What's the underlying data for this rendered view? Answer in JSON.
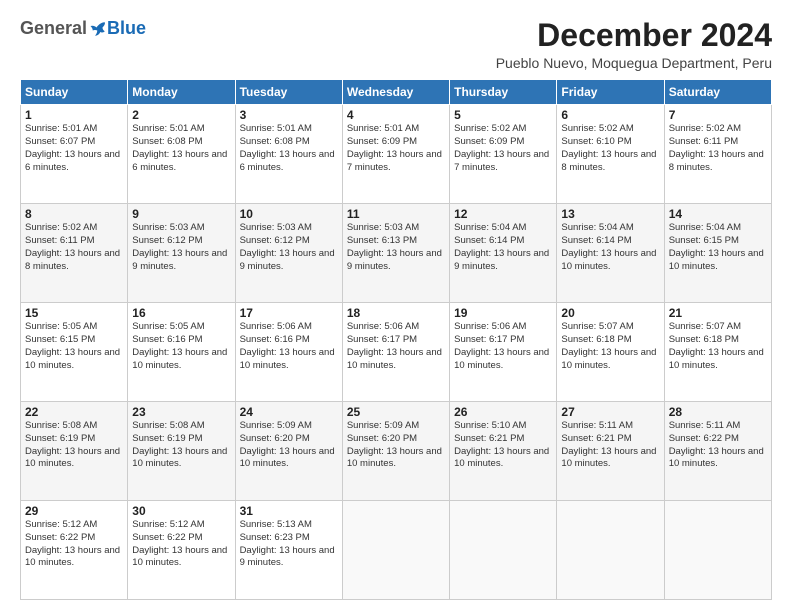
{
  "header": {
    "logo_general": "General",
    "logo_blue": "Blue",
    "month_title": "December 2024",
    "location": "Pueblo Nuevo, Moquegua Department, Peru"
  },
  "weekdays": [
    "Sunday",
    "Monday",
    "Tuesday",
    "Wednesday",
    "Thursday",
    "Friday",
    "Saturday"
  ],
  "weeks": [
    [
      {
        "day": "1",
        "sunrise": "5:01 AM",
        "sunset": "6:07 PM",
        "daylight": "13 hours and 6 minutes."
      },
      {
        "day": "2",
        "sunrise": "5:01 AM",
        "sunset": "6:08 PM",
        "daylight": "13 hours and 6 minutes."
      },
      {
        "day": "3",
        "sunrise": "5:01 AM",
        "sunset": "6:08 PM",
        "daylight": "13 hours and 6 minutes."
      },
      {
        "day": "4",
        "sunrise": "5:01 AM",
        "sunset": "6:09 PM",
        "daylight": "13 hours and 7 minutes."
      },
      {
        "day": "5",
        "sunrise": "5:02 AM",
        "sunset": "6:09 PM",
        "daylight": "13 hours and 7 minutes."
      },
      {
        "day": "6",
        "sunrise": "5:02 AM",
        "sunset": "6:10 PM",
        "daylight": "13 hours and 8 minutes."
      },
      {
        "day": "7",
        "sunrise": "5:02 AM",
        "sunset": "6:11 PM",
        "daylight": "13 hours and 8 minutes."
      }
    ],
    [
      {
        "day": "8",
        "sunrise": "5:02 AM",
        "sunset": "6:11 PM",
        "daylight": "13 hours and 8 minutes."
      },
      {
        "day": "9",
        "sunrise": "5:03 AM",
        "sunset": "6:12 PM",
        "daylight": "13 hours and 9 minutes."
      },
      {
        "day": "10",
        "sunrise": "5:03 AM",
        "sunset": "6:12 PM",
        "daylight": "13 hours and 9 minutes."
      },
      {
        "day": "11",
        "sunrise": "5:03 AM",
        "sunset": "6:13 PM",
        "daylight": "13 hours and 9 minutes."
      },
      {
        "day": "12",
        "sunrise": "5:04 AM",
        "sunset": "6:14 PM",
        "daylight": "13 hours and 9 minutes."
      },
      {
        "day": "13",
        "sunrise": "5:04 AM",
        "sunset": "6:14 PM",
        "daylight": "13 hours and 10 minutes."
      },
      {
        "day": "14",
        "sunrise": "5:04 AM",
        "sunset": "6:15 PM",
        "daylight": "13 hours and 10 minutes."
      }
    ],
    [
      {
        "day": "15",
        "sunrise": "5:05 AM",
        "sunset": "6:15 PM",
        "daylight": "13 hours and 10 minutes."
      },
      {
        "day": "16",
        "sunrise": "5:05 AM",
        "sunset": "6:16 PM",
        "daylight": "13 hours and 10 minutes."
      },
      {
        "day": "17",
        "sunrise": "5:06 AM",
        "sunset": "6:16 PM",
        "daylight": "13 hours and 10 minutes."
      },
      {
        "day": "18",
        "sunrise": "5:06 AM",
        "sunset": "6:17 PM",
        "daylight": "13 hours and 10 minutes."
      },
      {
        "day": "19",
        "sunrise": "5:06 AM",
        "sunset": "6:17 PM",
        "daylight": "13 hours and 10 minutes."
      },
      {
        "day": "20",
        "sunrise": "5:07 AM",
        "sunset": "6:18 PM",
        "daylight": "13 hours and 10 minutes."
      },
      {
        "day": "21",
        "sunrise": "5:07 AM",
        "sunset": "6:18 PM",
        "daylight": "13 hours and 10 minutes."
      }
    ],
    [
      {
        "day": "22",
        "sunrise": "5:08 AM",
        "sunset": "6:19 PM",
        "daylight": "13 hours and 10 minutes."
      },
      {
        "day": "23",
        "sunrise": "5:08 AM",
        "sunset": "6:19 PM",
        "daylight": "13 hours and 10 minutes."
      },
      {
        "day": "24",
        "sunrise": "5:09 AM",
        "sunset": "6:20 PM",
        "daylight": "13 hours and 10 minutes."
      },
      {
        "day": "25",
        "sunrise": "5:09 AM",
        "sunset": "6:20 PM",
        "daylight": "13 hours and 10 minutes."
      },
      {
        "day": "26",
        "sunrise": "5:10 AM",
        "sunset": "6:21 PM",
        "daylight": "13 hours and 10 minutes."
      },
      {
        "day": "27",
        "sunrise": "5:11 AM",
        "sunset": "6:21 PM",
        "daylight": "13 hours and 10 minutes."
      },
      {
        "day": "28",
        "sunrise": "5:11 AM",
        "sunset": "6:22 PM",
        "daylight": "13 hours and 10 minutes."
      }
    ],
    [
      {
        "day": "29",
        "sunrise": "5:12 AM",
        "sunset": "6:22 PM",
        "daylight": "13 hours and 10 minutes."
      },
      {
        "day": "30",
        "sunrise": "5:12 AM",
        "sunset": "6:22 PM",
        "daylight": "13 hours and 10 minutes."
      },
      {
        "day": "31",
        "sunrise": "5:13 AM",
        "sunset": "6:23 PM",
        "daylight": "13 hours and 9 minutes."
      },
      null,
      null,
      null,
      null
    ]
  ],
  "labels": {
    "sunrise": "Sunrise:",
    "sunset": "Sunset:",
    "daylight": "Daylight:"
  }
}
